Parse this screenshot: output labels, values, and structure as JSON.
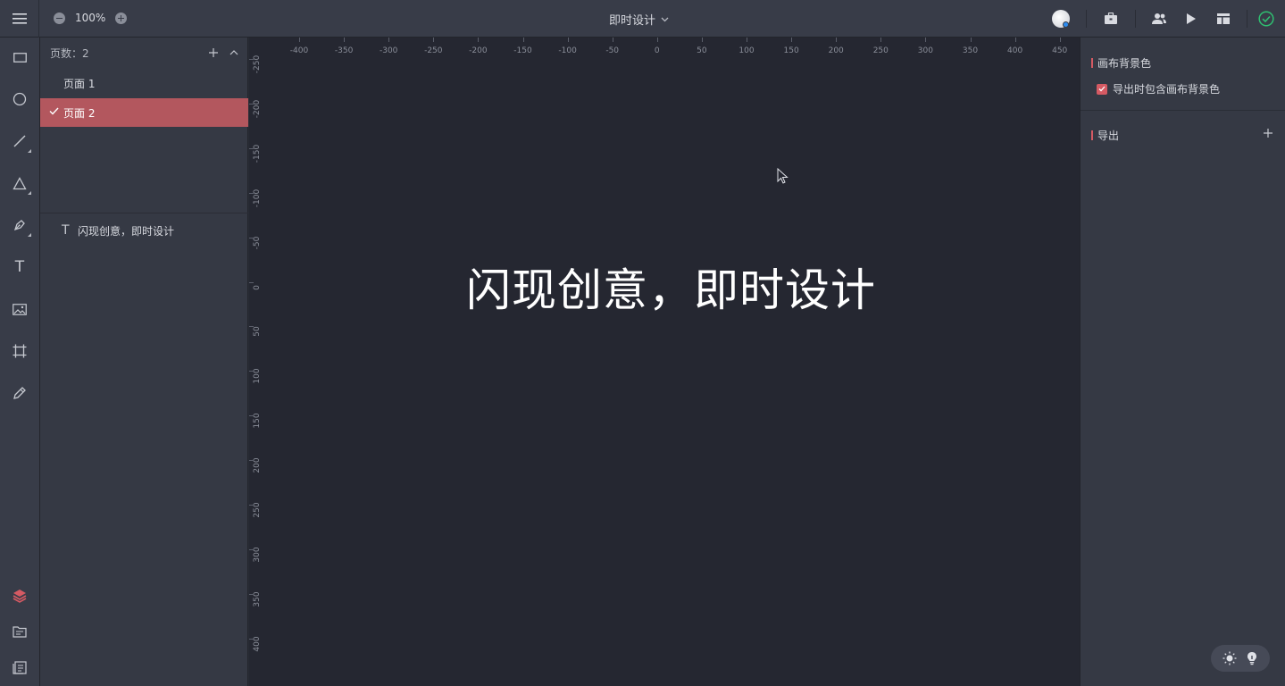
{
  "topbar": {
    "zoom_value": "100%",
    "doc_title": "即时设计"
  },
  "toolbar": {
    "tools": [
      {
        "name": "rectangle-tool"
      },
      {
        "name": "ellipse-tool"
      },
      {
        "name": "line-tool"
      },
      {
        "name": "polygon-tool"
      },
      {
        "name": "pen-tool"
      },
      {
        "name": "text-tool",
        "label": "T"
      },
      {
        "name": "image-tool"
      },
      {
        "name": "frame-tool"
      },
      {
        "name": "pencil-tool"
      }
    ],
    "bottom": [
      "layers-icon",
      "assets-icon",
      "components-icon"
    ]
  },
  "pages": {
    "header": "页数：2",
    "items": [
      {
        "label": "页面 1",
        "active": false
      },
      {
        "label": "页面 2",
        "active": true
      }
    ]
  },
  "layers": {
    "items": [
      {
        "label": "闪现创意，即时设计",
        "type": "text",
        "icon": "T"
      }
    ]
  },
  "canvas": {
    "text": "闪现创意，即时设计",
    "ruler_top": [
      "-400",
      "-350",
      "-300",
      "-250",
      "-200",
      "-150",
      "-100",
      "-50",
      "0",
      "50",
      "100",
      "150",
      "200",
      "250",
      "300",
      "350",
      "400",
      "450"
    ],
    "ruler_left": [
      "-250",
      "-200",
      "-150",
      "-100",
      "-50",
      "0",
      "50",
      "100",
      "150",
      "200",
      "250",
      "300",
      "350",
      "400"
    ]
  },
  "right_panel": {
    "bg_section": "画布背景色",
    "bg_checkbox_label": "导出时包含画布背景色",
    "bg_checkbox_checked": true,
    "export_section": "导出"
  },
  "colors": {
    "accent": "#d55a63",
    "active_page": "#b3575e",
    "canvas_bg": "#252731",
    "panel_bg": "#353944",
    "topbar_bg": "#383c48",
    "success": "#2fbf71"
  }
}
